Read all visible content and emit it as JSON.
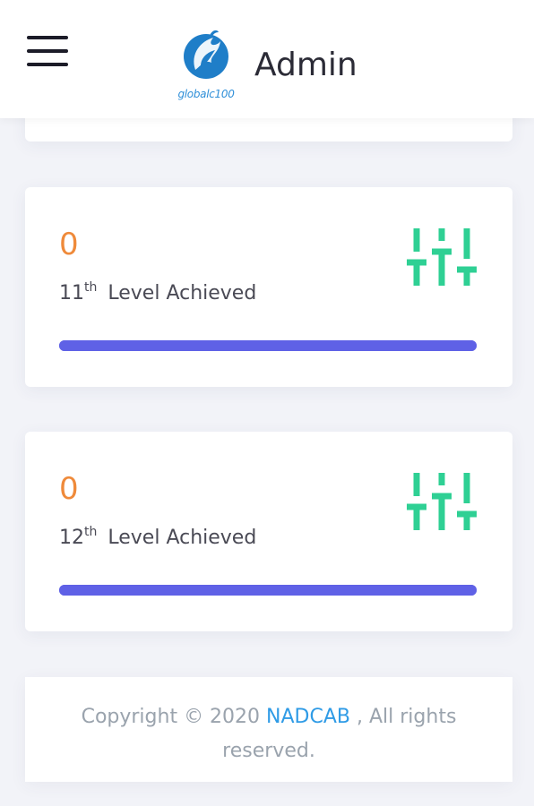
{
  "header": {
    "title": "Admin",
    "logo_text": "globalc100",
    "menu_icon": "hamburger-menu-icon"
  },
  "cards": [
    {
      "count": "0",
      "level_number": "11",
      "level_suffix": "th",
      "level_label": "Level Achieved",
      "progress": 1.0,
      "icon": "sliders-icon"
    },
    {
      "count": "0",
      "level_number": "12",
      "level_suffix": "th",
      "level_label": "Level Achieved",
      "progress": 1.0,
      "icon": "sliders-icon"
    }
  ],
  "footer": {
    "prefix": "Copyright © 2020 ",
    "link": "NADCAB",
    "suffix": " , All rights reserved."
  },
  "colors": {
    "count": "#ef8a3a",
    "icon": "#2fd094",
    "progress": "#5f61e6",
    "link": "#2f9be6"
  }
}
